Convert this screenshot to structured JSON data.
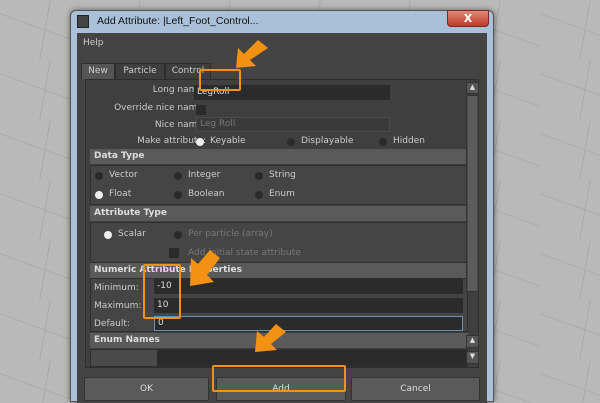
{
  "window": {
    "title": "Add Attribute: |Left_Foot_Control...",
    "close_label": "X"
  },
  "menu": {
    "help": "Help"
  },
  "tabs": [
    {
      "label": "New",
      "active": true
    },
    {
      "label": "Particle"
    },
    {
      "label": "Control"
    }
  ],
  "form": {
    "long_name_label": "Long name:",
    "long_name_value": "LegRoll",
    "override_label": "Override nice name:",
    "nice_name_label": "Nice name:",
    "nice_name_value": "Leg Roll",
    "make_attr_label": "Make attribute:",
    "make_attr_options": [
      "Keyable",
      "Displayable",
      "Hidden"
    ],
    "make_attr_selected": "Keyable"
  },
  "data_type": {
    "header": "Data Type",
    "options": [
      "Vector",
      "Integer",
      "String",
      "Float",
      "Boolean",
      "Enum"
    ],
    "selected": "Float"
  },
  "attribute_type": {
    "header": "Attribute Type",
    "scalar": "Scalar",
    "per_particle": "Per particle (array)",
    "initial_state": "Add initial state attribute",
    "selected": "Scalar"
  },
  "numeric": {
    "header": "Numeric Attribute Properties",
    "min_label": "Minimum:",
    "min_value": "-10",
    "max_label": "Maximum:",
    "max_value": "10",
    "default_label": "Default:",
    "default_value": "0"
  },
  "enum": {
    "header": "Enum Names"
  },
  "buttons": {
    "ok": "OK",
    "add": "Add",
    "cancel": "Cancel"
  },
  "colors": {
    "highlight": "#f39212",
    "panel": "#444444"
  }
}
